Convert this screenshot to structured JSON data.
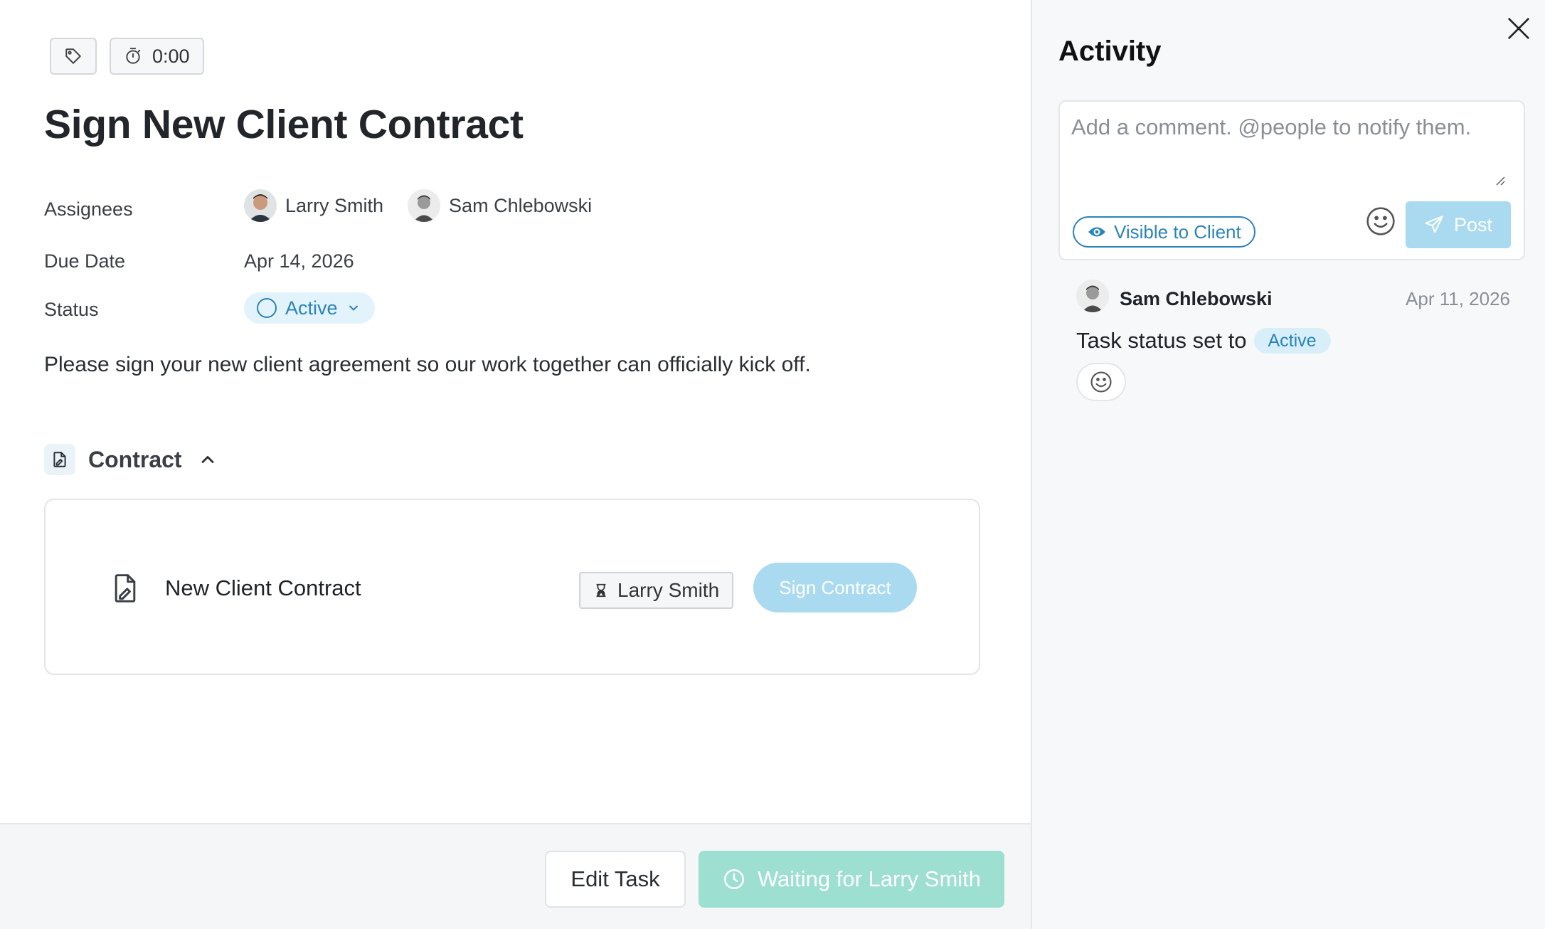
{
  "task": {
    "title": "Sign New Client Contract",
    "timer": "0:00",
    "tag_icon": "tag-icon",
    "timer_icon": "stopwatch-icon"
  },
  "fields": {
    "assignees_label": "Assignees",
    "assignees": [
      {
        "name": "Larry Smith"
      },
      {
        "name": "Sam Chlebowski"
      }
    ],
    "due_date_label": "Due Date",
    "due_date": "Apr 14, 2026",
    "status_label": "Status",
    "status": "Active"
  },
  "description": "Please sign your new client agreement so our work together can officially kick off.",
  "contract_section": {
    "title": "Contract",
    "document_name": "New Client Contract",
    "signer": "Larry Smith",
    "sign_button": "Sign Contract"
  },
  "footer": {
    "edit_button": "Edit Task",
    "waiting_button": "Waiting for Larry Smith"
  },
  "activity": {
    "title": "Activity",
    "comment_placeholder": "Add a comment. @people to notify them.",
    "visibility_label": "Visible to Client",
    "post_button": "Post",
    "items": [
      {
        "user": "Sam Chlebowski",
        "date": "Apr 11, 2026",
        "text": "Task status set to",
        "badge": "Active"
      }
    ]
  },
  "colors": {
    "accent_blue": "#2a84b8",
    "light_blue_button": "#a9daf0",
    "waiting_green": "#9ddfd0",
    "status_pill_bg": "#e3f3fb"
  }
}
